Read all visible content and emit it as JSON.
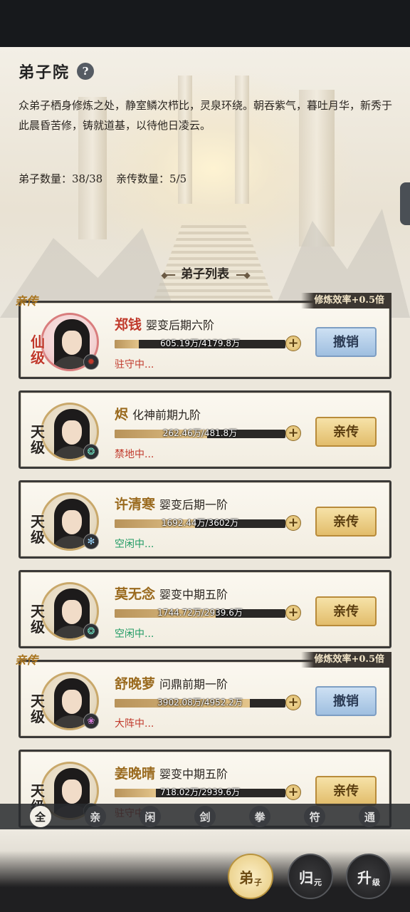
{
  "header": {
    "title": "弟子院",
    "help": "?"
  },
  "description": "众弟子栖身修炼之处，静室鳞次栉比，灵泉环绕。朝吞紫气，暮吐月华，新秀于此晨昏苦修，铸就道基，以待他日凌云。",
  "counts": {
    "disciples": "弟子数量：38/38",
    "direct": "亲传数量：5/5"
  },
  "section_title": "弟子列表",
  "disciples": [
    {
      "tag": "亲传",
      "badge": "修炼效率+0.5倍",
      "grade": "仙\n级",
      "name": "郑钱",
      "realm": "婴变后期六阶",
      "exp": "605.19万/4179.8万",
      "progress": 0.14,
      "status": "驻守中...",
      "status_color": "red",
      "element": "火",
      "action": "撤销"
    },
    {
      "tag": "",
      "badge": "",
      "grade": "天\n级",
      "name": "烬",
      "realm": "化神前期九阶",
      "exp": "262.46万/481.8万",
      "progress": 0.54,
      "status": "禁地中...",
      "status_color": "red",
      "element": "风",
      "action": "亲传"
    },
    {
      "tag": "",
      "badge": "",
      "grade": "天\n级",
      "name": "许清寒",
      "realm": "婴变后期一阶",
      "exp": "1692.44万/3602万",
      "progress": 0.47,
      "status": "空闲中...",
      "status_color": "green",
      "element": "冰",
      "action": "亲传"
    },
    {
      "tag": "",
      "badge": "",
      "grade": "天\n级",
      "name": "莫无念",
      "realm": "婴变中期五阶",
      "exp": "1744.72万/2939.6万",
      "progress": 0.59,
      "status": "空闲中...",
      "status_color": "green",
      "element": "风",
      "action": "亲传"
    },
    {
      "tag": "亲传",
      "badge": "修炼效率+0.5倍",
      "grade": "天\n级",
      "name": "舒晚萝",
      "realm": "问鼎前期一阶",
      "exp": "3902.08万/4952.2万",
      "progress": 0.79,
      "status": "大阵中...",
      "status_color": "red",
      "element": "旋",
      "action": "撤销"
    },
    {
      "tag": "",
      "badge": "",
      "grade": "天\n级",
      "name": "姜晚晴",
      "realm": "婴变中期五阶",
      "exp": "718.02万/2939.6万",
      "progress": 0.24,
      "status": "驻守中...",
      "status_color": "red",
      "element": "风",
      "action": "亲传"
    }
  ],
  "filters": [
    "全",
    "亲",
    "闲",
    "剑",
    "拳",
    "符",
    "通"
  ],
  "active_filter": 0,
  "bottom_nav": [
    {
      "main": "弟",
      "sub": "子"
    },
    {
      "main": "归",
      "sub": "元"
    },
    {
      "main": "升",
      "sub": "级"
    }
  ]
}
